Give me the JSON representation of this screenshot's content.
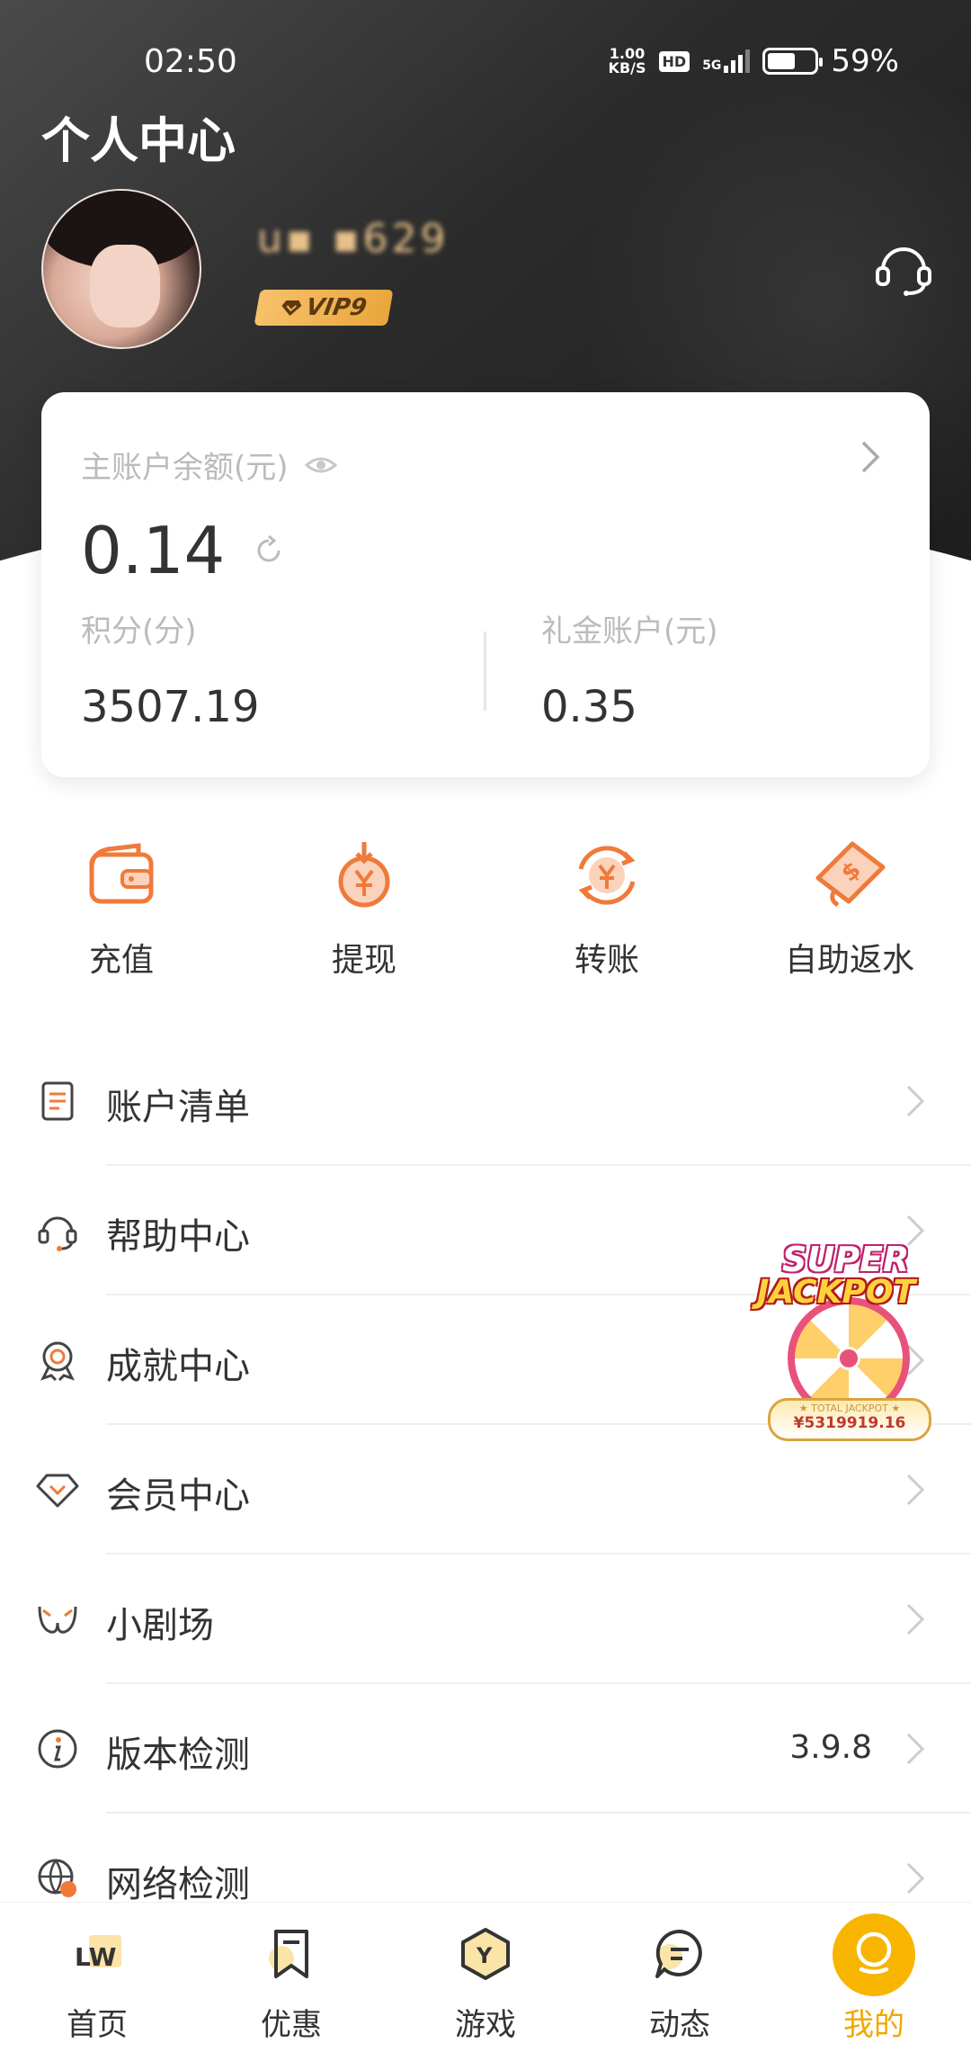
{
  "status_bar": {
    "time": "02:50",
    "net_speed_value": "1.00",
    "net_speed_unit": "KB/S",
    "hd_label": "HD",
    "network_label": "5G",
    "battery_percent": "59%",
    "battery_level": 0.59
  },
  "header": {
    "title": "个人中心",
    "username": "u▪ ▪629",
    "vip_label": "VIP9"
  },
  "balance_card": {
    "main_label": "主账户余额(元)",
    "main_amount": "0.14",
    "points_label": "积分(分)",
    "points_value": "3507.19",
    "gift_label": "礼金账户(元)",
    "gift_value": "0.35"
  },
  "actions": [
    {
      "label": "充值",
      "icon": "wallet-icon"
    },
    {
      "label": "提现",
      "icon": "withdraw-icon"
    },
    {
      "label": "转账",
      "icon": "transfer-icon"
    },
    {
      "label": "自助返水",
      "icon": "rebate-icon"
    }
  ],
  "menu": [
    {
      "label": "账户清单",
      "icon": "statement-icon",
      "value": ""
    },
    {
      "label": "帮助中心",
      "icon": "headset-icon",
      "value": ""
    },
    {
      "label": "成就中心",
      "icon": "medal-icon",
      "value": ""
    },
    {
      "label": "会员中心",
      "icon": "diamond-icon",
      "value": ""
    },
    {
      "label": "小剧场",
      "icon": "theater-icon",
      "value": ""
    },
    {
      "label": "版本检测",
      "icon": "info-icon",
      "value": "3.9.8"
    },
    {
      "label": "网络检测",
      "icon": "globe-icon",
      "value": ""
    }
  ],
  "jackpot": {
    "line1": "SUPER",
    "line2": "JACKPOT",
    "caption": "★ TOTAL JACKPOT ★",
    "amount": "¥5319919.16"
  },
  "tabbar": [
    {
      "label": "首页",
      "icon_text": "LW"
    },
    {
      "label": "优惠",
      "icon_text": ""
    },
    {
      "label": "游戏",
      "icon_text": "Y"
    },
    {
      "label": "动态",
      "icon_text": ""
    },
    {
      "label": "我的",
      "icon_text": ""
    }
  ],
  "colors": {
    "accent_orange": "#f07a3a",
    "tab_active": "#f7b500",
    "vip_gold": "#f0b457"
  }
}
